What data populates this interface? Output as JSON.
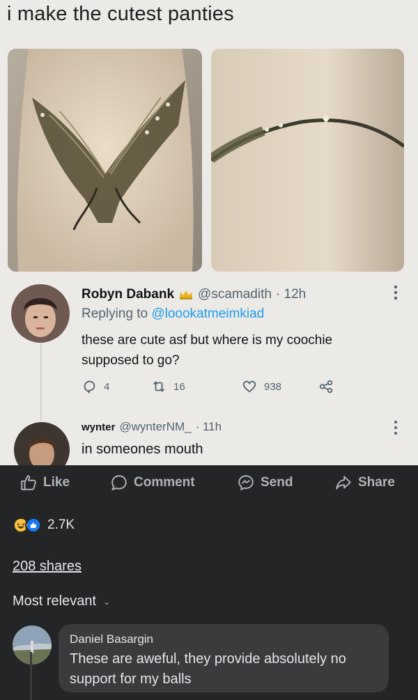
{
  "post": {
    "title": "i make the cutest panties"
  },
  "tweet": {
    "name": "Robyn Dabank",
    "handle": "@scamadith",
    "time": "· 12h",
    "replying_prefix": "Replying to",
    "replying_to": "@loookatmeimkiad",
    "text": "these are cute asf but where is my coochie supposed to go?",
    "replies": "4",
    "retweets": "16",
    "likes": "938"
  },
  "reply": {
    "name": "wynter",
    "handle": "@wynterNM_",
    "time": "· 11h",
    "text": "in someones mouth"
  },
  "facebook": {
    "actions": {
      "like": "Like",
      "comment": "Comment",
      "send": "Send",
      "share": "Share"
    },
    "reaction_count": "2.7K",
    "shares": "208 shares",
    "sort_label": "Most relevant",
    "comment": {
      "author": "Daniel Basargin",
      "text": "These are aweful, they provide absolutely no support for my balls"
    }
  },
  "colors": {
    "twitter_blue": "#1d9bf0",
    "fb_dark": "#242526",
    "bubble": "#3a3b3c",
    "like_blue": "#1877f2",
    "haha_yellow": "#f7c23b"
  }
}
